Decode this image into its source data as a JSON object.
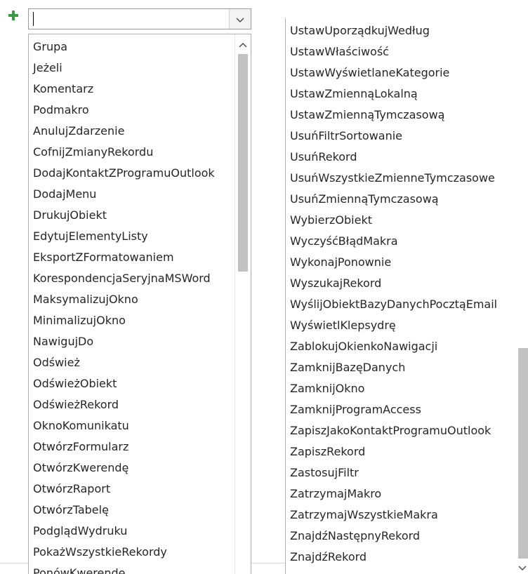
{
  "toolbar": {
    "add_icon": "plus-icon"
  },
  "combo": {
    "value": "",
    "dropdown_icon": "chevron-down-icon"
  },
  "left_list": {
    "items": [
      "Grupa",
      "Jeżeli",
      "Komentarz",
      "Podmakro",
      "AnulujZdarzenie",
      "CofnijZmianyRekordu",
      "DodajKontaktZProgramuOutlook",
      "DodajMenu",
      "DrukujObiekt",
      "EdytujElementyListy",
      "EksportZFormatowaniem",
      "KorespondencjaSeryjnaMSWord",
      "MaksymalizujOkno",
      "MinimalizujOkno",
      "NawigujDo",
      "Odśwież",
      "OdświeżObiekt",
      "OdświeżRekord",
      "OknoKomunikatu",
      "OtwórzFormularz",
      "OtwórzKwerendę",
      "OtwórzRaport",
      "OtwórzTabelę",
      "PodglądWydruku",
      "PokażWszystkieRekordy",
      "PonówKwerendę"
    ],
    "scroll_up_icon": "chevron-up-icon"
  },
  "right_list": {
    "items": [
      "UstawUporządkujWedług",
      "UstawWłaściwość",
      "UstawWyświetlaneKategorie",
      "UstawZmiennąLokalną",
      "UstawZmiennąTymczasową",
      "UsuńFiltrSortowanie",
      "UsuńRekord",
      "UsuńWszystkieZmienneTymczasowe",
      "UsuńZmiennąTymczasową",
      "WybierzObiekt",
      "WyczyśćBłądMakra",
      "WykonajPonownie",
      "WyszukajRekord",
      "WyślijObiektBazyDanychPocztąEmail",
      "WyświetlKlepsydrę",
      "ZablokujOkienkoNawigacji",
      "ZamknijBazęDanych",
      "ZamknijOkno",
      "ZamknijProgramAccess",
      "ZapiszJakoKontaktProgramuOutlook",
      "ZapiszRekord",
      "ZastosujFiltr",
      "ZatrzymajMakro",
      "ZatrzymajWszystkieMakra",
      "ZnajdźNastępnyRekord",
      "ZnajdźRekord"
    ],
    "scroll_down_icon": "chevron-down-icon"
  }
}
